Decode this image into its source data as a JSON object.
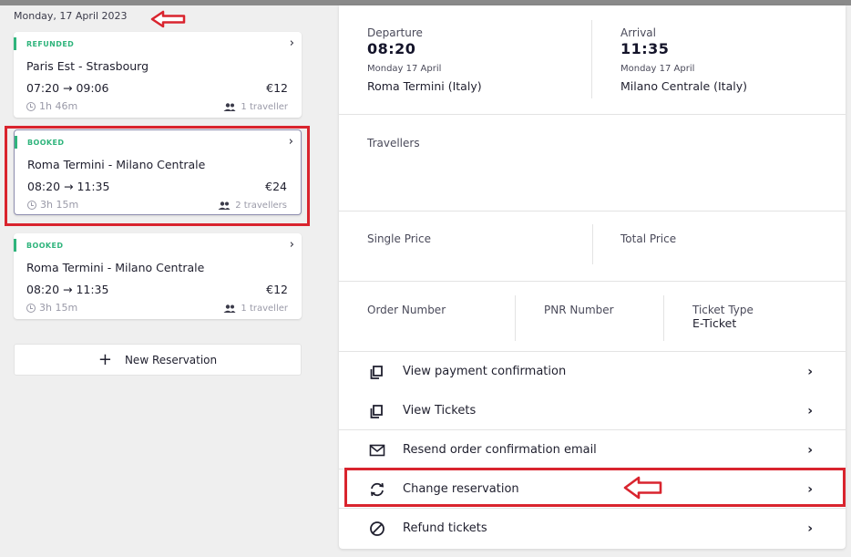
{
  "date_header": "Monday, 17 April 2023",
  "reservations": [
    {
      "status": "REFUNDED",
      "route": "Paris Est  -  Strasbourg",
      "times": "07:20  →  09:06",
      "price": "€12",
      "duration": "1h 46m",
      "travellers": "1 traveller"
    },
    {
      "status": "BOOKED",
      "route": "Roma Termini  -  Milano Centrale",
      "times": "08:20  →  11:35",
      "price": "€24",
      "duration": "3h 15m",
      "travellers": "2 travellers"
    },
    {
      "status": "BOOKED",
      "route": "Roma Termini  -  Milano Centrale",
      "times": "08:20  →  11:35",
      "price": "€12",
      "duration": "3h 15m",
      "travellers": "1 traveller"
    }
  ],
  "new_reservation_label": "New Reservation",
  "details": {
    "departure": {
      "label": "Departure",
      "time": "08:20",
      "date": "Monday 17 April",
      "station": "Roma Termini (Italy)"
    },
    "arrival": {
      "label": "Arrival",
      "time": "11:35",
      "date": "Monday 17 April",
      "station": "Milano Centrale (Italy)"
    },
    "travellers_label": "Travellers",
    "single_price_label": "Single Price",
    "total_price_label": "Total Price",
    "order_number_label": "Order Number",
    "pnr_number_label": "PNR Number",
    "ticket_type_label": "Ticket Type",
    "ticket_type_value": "E-Ticket"
  },
  "actions": [
    {
      "label": "View payment confirmation",
      "icon": "copy-icon"
    },
    {
      "label": "View Tickets",
      "icon": "copy-icon"
    },
    {
      "label": "Resend order confirmation email",
      "icon": "envelope-icon"
    },
    {
      "label": "Change reservation",
      "icon": "refresh-icon"
    },
    {
      "label": "Refund tickets",
      "icon": "ban-icon"
    }
  ],
  "colors": {
    "status_green": "#2fb47c",
    "highlight_red": "#d9242e"
  }
}
